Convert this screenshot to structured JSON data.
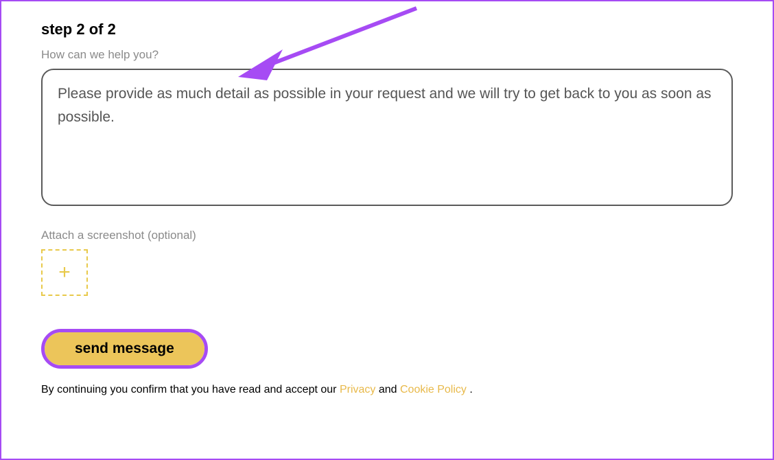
{
  "step": {
    "title": "step 2 of 2"
  },
  "help": {
    "label": "How can we help you?",
    "placeholder": "Please provide as much detail as possible in your request and we will try to get back to you as soon as possible."
  },
  "attach": {
    "label": "Attach a screenshot (optional)"
  },
  "button": {
    "send_label": "send message"
  },
  "disclaimer": {
    "prefix": "By continuing you confirm that you have read and accept our ",
    "privacy_link": "Privacy",
    "and": " and ",
    "cookie_link": "Cookie Policy ",
    "suffix": "."
  },
  "colors": {
    "accent_purple": "#a64bf4",
    "accent_yellow": "#ecc55a",
    "link_yellow": "#e8b94a"
  }
}
